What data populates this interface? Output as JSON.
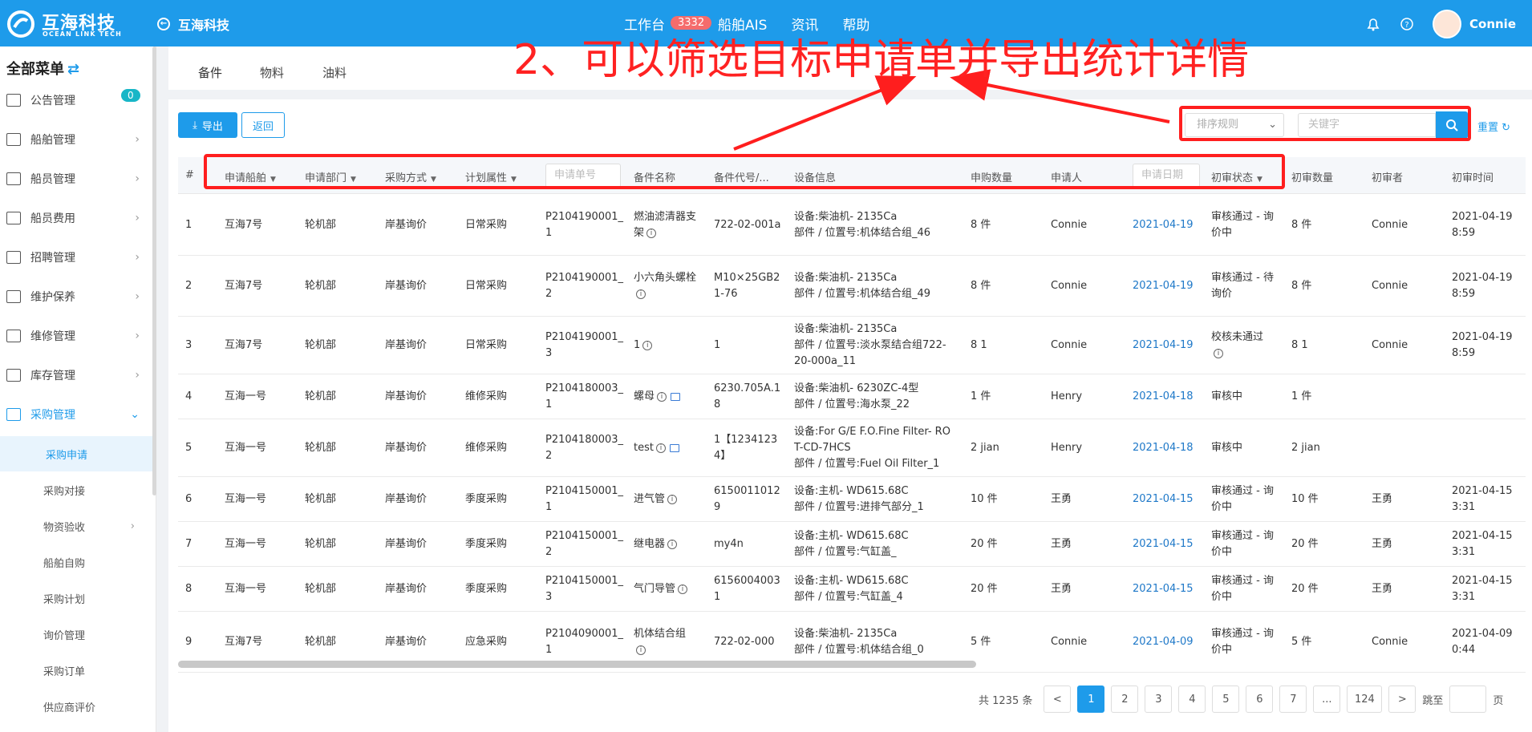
{
  "header": {
    "logo_cn": "互海科技",
    "logo_en": "OCEAN LINK TECH",
    "org": "互海科技",
    "nav": [
      {
        "label": "工作台",
        "badge": "3332"
      },
      {
        "label": "船舶AIS"
      },
      {
        "label": "资讯"
      },
      {
        "label": "帮助"
      }
    ],
    "user": "Connie"
  },
  "annotation": "2、可以筛选目标申请单并导出统计详情",
  "sidebar": {
    "title": "全部菜单",
    "notice_badge": "0",
    "items": [
      "公告管理",
      "船舶管理",
      "船员管理",
      "船员费用",
      "招聘管理",
      "维护保养",
      "维修管理",
      "库存管理",
      "采购管理"
    ],
    "subitems": [
      "采购申请",
      "采购对接",
      "物资验收",
      "船舶自购",
      "采购计划",
      "询价管理",
      "采购订单",
      "供应商评价"
    ]
  },
  "tabs": [
    "备件",
    "物料",
    "油料"
  ],
  "toolbar": {
    "export": "导出",
    "back": "返回",
    "sort_placeholder": "排序规则",
    "keyword_placeholder": "关键字",
    "reset": "重置"
  },
  "table": {
    "headers": [
      "#",
      "申请船舶",
      "申请部门",
      "采购方式",
      "计划属性",
      "申请单号",
      "备件名称",
      "备件代号/...",
      "设备信息",
      "申购数量",
      "申请人",
      "申请日期",
      "初审状态",
      "初审数量",
      "初审者",
      "初审时间"
    ],
    "rows": [
      {
        "no": "1",
        "ship": "互海7号",
        "dept": "轮机部",
        "method": "岸基询价",
        "plan": "日常采购",
        "order": [
          "P2104190001_",
          "1"
        ],
        "name": [
          "燃油滤清器支",
          "架"
        ],
        "code": [
          "722-02-001a"
        ],
        "device": [
          "设备:柴油机- 2135Ca",
          "部件 / 位置号:机体结合组_46"
        ],
        "qty": "8 件",
        "applicant": "Connie",
        "date": "2021-04-19",
        "status": [
          "审核通过 - 询",
          "价中"
        ],
        "rqty": "8 件",
        "reviewer": "Connie",
        "rtime": [
          "2021-04-19",
          "8:59"
        ],
        "img": false
      },
      {
        "no": "2",
        "ship": "互海7号",
        "dept": "轮机部",
        "method": "岸基询价",
        "plan": "日常采购",
        "order": [
          "P2104190001_",
          "2"
        ],
        "name": [
          "小六角头螺栓",
          ""
        ],
        "code": [
          "M10×25GB2",
          "1-76"
        ],
        "device": [
          "设备:柴油机- 2135Ca",
          "部件 / 位置号:机体结合组_49"
        ],
        "qty": "8 件",
        "applicant": "Connie",
        "date": "2021-04-19",
        "status": [
          "审核通过 - 待",
          "询价"
        ],
        "rqty": "8 件",
        "reviewer": "Connie",
        "rtime": [
          "2021-04-19",
          "8:59"
        ],
        "img": false
      },
      {
        "no": "3",
        "ship": "互海7号",
        "dept": "轮机部",
        "method": "岸基询价",
        "plan": "日常采购",
        "order": [
          "P2104190001_",
          "3"
        ],
        "name": [
          "1"
        ],
        "code": [
          "1"
        ],
        "device": [
          "设备:柴油机- 2135Ca",
          "部件 / 位置号:淡水泵结合组722-",
          "20-000a_11"
        ],
        "qty": "8 1",
        "applicant": "Connie",
        "date": "2021-04-19",
        "status": [
          "校核未通过",
          ""
        ],
        "rqty": "8 1",
        "reviewer": "Connie",
        "rtime": [
          "2021-04-19",
          "8:59"
        ],
        "img": false
      },
      {
        "no": "4",
        "ship": "互海一号",
        "dept": "轮机部",
        "method": "岸基询价",
        "plan": "维修采购",
        "order": [
          "P2104180003_",
          "1"
        ],
        "name": [
          "螺母"
        ],
        "code": [
          "6230.705A.1",
          "8"
        ],
        "device": [
          "设备:柴油机- 6230ZC-4型",
          "部件 / 位置号:海水泵_22"
        ],
        "qty": "1 件",
        "applicant": "Henry",
        "date": "2021-04-18",
        "status": [
          "审核中"
        ],
        "rqty": "1 件",
        "reviewer": "",
        "rtime": [],
        "img": true
      },
      {
        "no": "5",
        "ship": "互海一号",
        "dept": "轮机部",
        "method": "岸基询价",
        "plan": "维修采购",
        "order": [
          "P2104180003_",
          "2"
        ],
        "name": [
          "test"
        ],
        "code": [
          "1【1234123",
          "4】"
        ],
        "device": [
          "设备:For G/E F.O.Fine Filter- RO",
          "T-CD-7HCS",
          "部件 / 位置号:Fuel Oil Filter_1"
        ],
        "qty": "2 jian",
        "applicant": "Henry",
        "date": "2021-04-18",
        "status": [
          "审核中"
        ],
        "rqty": "2 jian",
        "reviewer": "",
        "rtime": [],
        "img": true
      },
      {
        "no": "6",
        "ship": "互海一号",
        "dept": "轮机部",
        "method": "岸基询价",
        "plan": "季度采购",
        "order": [
          "P2104150001_",
          "1"
        ],
        "name": [
          "进气管"
        ],
        "code": [
          "6150011012",
          "9"
        ],
        "device": [
          "设备:主机- WD615.68C",
          "部件 / 位置号:进排气部分_1"
        ],
        "qty": "10 件",
        "applicant": "王勇",
        "date": "2021-04-15",
        "status": [
          "审核通过 - 询",
          "价中"
        ],
        "rqty": "10 件",
        "reviewer": "王勇",
        "rtime": [
          "2021-04-15",
          "3:31"
        ],
        "img": false
      },
      {
        "no": "7",
        "ship": "互海一号",
        "dept": "轮机部",
        "method": "岸基询价",
        "plan": "季度采购",
        "order": [
          "P2104150001_",
          "2"
        ],
        "name": [
          "继电器"
        ],
        "code": [
          "my4n"
        ],
        "device": [
          "设备:主机- WD615.68C",
          "部件 / 位置号:气缸盖_"
        ],
        "qty": "20 件",
        "applicant": "王勇",
        "date": "2021-04-15",
        "status": [
          "审核通过 - 询",
          "价中"
        ],
        "rqty": "20 件",
        "reviewer": "王勇",
        "rtime": [
          "2021-04-15",
          "3:31"
        ],
        "img": false
      },
      {
        "no": "8",
        "ship": "互海一号",
        "dept": "轮机部",
        "method": "岸基询价",
        "plan": "季度采购",
        "order": [
          "P2104150001_",
          "3"
        ],
        "name": [
          "气门导管"
        ],
        "code": [
          "6156004003",
          "1"
        ],
        "device": [
          "设备:主机- WD615.68C",
          "部件 / 位置号:气缸盖_4"
        ],
        "qty": "20 件",
        "applicant": "王勇",
        "date": "2021-04-15",
        "status": [
          "审核通过 - 询",
          "价中"
        ],
        "rqty": "20 件",
        "reviewer": "王勇",
        "rtime": [
          "2021-04-15",
          "3:31"
        ],
        "img": false
      },
      {
        "no": "9",
        "ship": "互海7号",
        "dept": "轮机部",
        "method": "岸基询价",
        "plan": "应急采购",
        "order": [
          "P2104090001_",
          "1"
        ],
        "name": [
          "机体结合组",
          ""
        ],
        "code": [
          "722-02-000"
        ],
        "device": [
          "设备:柴油机- 2135Ca",
          "部件 / 位置号:机体结合组_0"
        ],
        "qty": "5 件",
        "applicant": "Connie",
        "date": "2021-04-09",
        "status": [
          "审核通过 - 询",
          "价中"
        ],
        "rqty": "5 件",
        "reviewer": "Connie",
        "rtime": [
          "2021-04-09",
          "0:44"
        ],
        "img": false
      }
    ]
  },
  "pagination": {
    "total": "共 1235 条",
    "prev": "<",
    "next": ">",
    "pages": [
      "1",
      "2",
      "3",
      "4",
      "5",
      "6",
      "7",
      "...",
      "124"
    ],
    "current": "1",
    "jump_label": "跳至",
    "page_suffix": "页"
  },
  "colors": {
    "primary": "#1e9bea",
    "annotation": "#ff1e1e",
    "badge": "#f56c6c"
  }
}
